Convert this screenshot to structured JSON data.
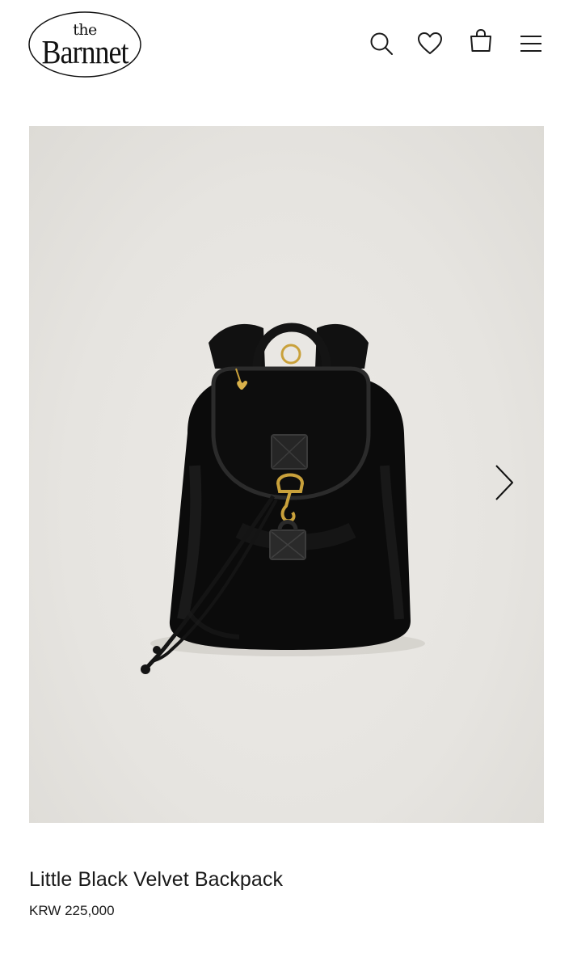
{
  "header": {
    "logo_small": "the",
    "logo_name": "Barnnet",
    "icons": [
      "search-icon",
      "heart-icon",
      "shopping-bag-icon",
      "menu-icon"
    ]
  },
  "gallery": {
    "next_icon": "chevron-right-icon",
    "image_subject": "black velvet backpack"
  },
  "product": {
    "title": "Little Black Velvet Backpack",
    "price": "KRW 225,000"
  },
  "colors": {
    "text": "#1a1a1a",
    "image_bg": "#e6e4e0",
    "bag": "#0d0d0d",
    "hardware": "#c9a13b"
  }
}
